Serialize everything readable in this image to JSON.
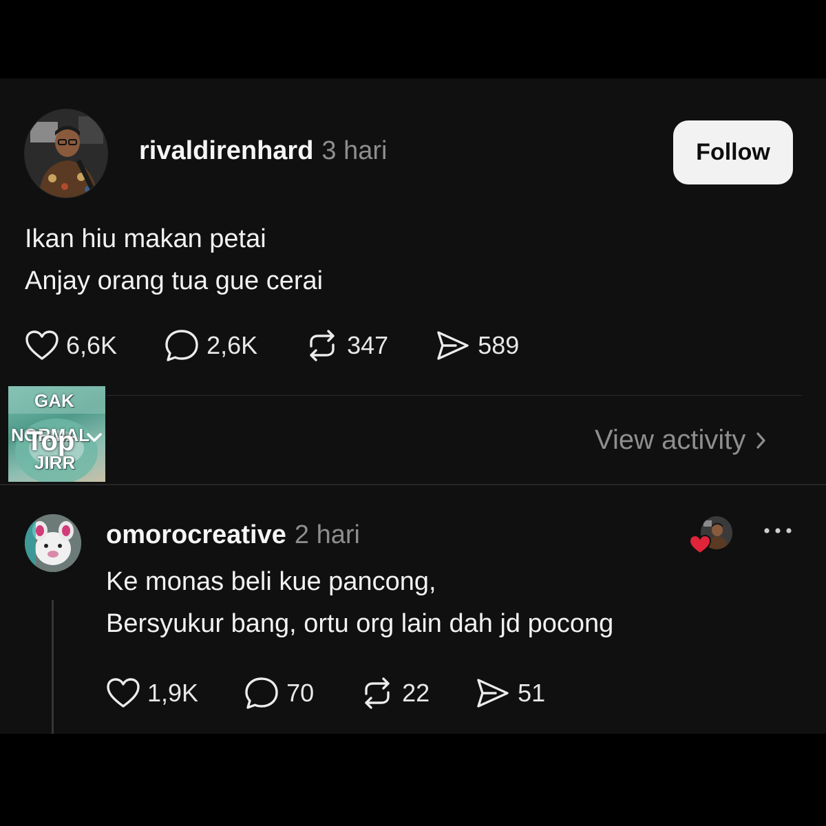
{
  "post": {
    "username": "rivaldirenhard",
    "timestamp": "3 hari",
    "follow_label": "Follow",
    "body_lines": [
      "Ikan hiu makan petai",
      "Anjay orang tua gue cerai"
    ],
    "stats": {
      "likes": "6,6K",
      "replies": "2,6K",
      "reposts": "347",
      "shares": "589"
    }
  },
  "replies_header": {
    "sort_label": "Top",
    "sort_thumbnail_text": [
      "GAK",
      "NORMAL",
      "JIRR"
    ],
    "view_activity_label": "View activity"
  },
  "reply": {
    "username": "omorocreative",
    "timestamp": "2 hari",
    "body_lines": [
      "Ke monas beli kue pancong,",
      "Bersyukur bang, ortu org lain dah jd pocong"
    ],
    "stats": {
      "likes": "1,9K",
      "replies": "70",
      "reposts": "22",
      "shares": "51"
    }
  },
  "icons": {
    "like": "heart-icon",
    "reply": "speech-bubble-icon",
    "repost": "repost-arrows-icon",
    "share": "send-icon",
    "more": "more-dots-icon",
    "chevron": "chevron-right-icon"
  },
  "colors": {
    "background": "#101010",
    "text": "#f3f3f3",
    "muted": "#8e8e8e",
    "follow_button": "#f2f2f2",
    "liked_heart": "#e0243a"
  }
}
